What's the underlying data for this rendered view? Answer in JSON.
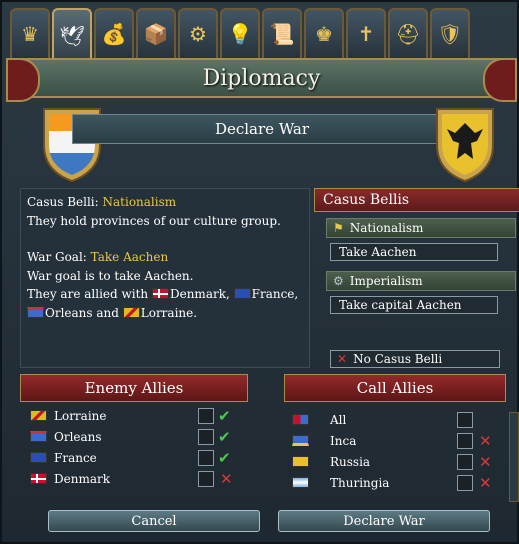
{
  "tabs": [
    {
      "name": "crown-icon",
      "glyph": "♛"
    },
    {
      "name": "dove-icon",
      "glyph": "🕊"
    },
    {
      "name": "money-bag-icon",
      "glyph": "💰"
    },
    {
      "name": "crate-icon",
      "glyph": "📦"
    },
    {
      "name": "gears-icon",
      "glyph": "⚙"
    },
    {
      "name": "lightbulb-icon",
      "glyph": "💡"
    },
    {
      "name": "scroll-icon",
      "glyph": "📜"
    },
    {
      "name": "cap-icon",
      "glyph": "♚"
    },
    {
      "name": "cross-icon",
      "glyph": "✝"
    },
    {
      "name": "helmet-icon",
      "glyph": "⛑"
    },
    {
      "name": "shield-crest-icon",
      "glyph": "🛡"
    }
  ],
  "title": "Diplomacy",
  "subheader": "Declare War",
  "casus_text": {
    "cb_label": "Casus Belli: ",
    "cb_value": "Nationalism",
    "line2": "They hold provinces of our culture group.",
    "wg_label": "War Goal: ",
    "wg_value": "Take Aachen",
    "line4": "War goal is to take Aachen.",
    "allied_prefix": "They are allied with ",
    "ally1": "Denmark,",
    "ally2": "France,",
    "ally3": "Orleans and ",
    "ally4": "Lorraine."
  },
  "casus_bellis": {
    "header": "Casus Bellis",
    "items": [
      {
        "label": "Nationalism",
        "goal": "Take Aachen"
      },
      {
        "label": "Imperialism",
        "goal": "Take capital Aachen"
      }
    ],
    "none_label": "No Casus Belli"
  },
  "enemy_allies": {
    "header": "Enemy Allies",
    "rows": [
      {
        "name": "Lorraine",
        "status": "check"
      },
      {
        "name": "Orleans",
        "status": "check"
      },
      {
        "name": "France",
        "status": "check"
      },
      {
        "name": "Denmark",
        "status": "cross"
      }
    ]
  },
  "call_allies": {
    "header": "Call Allies",
    "rows": [
      {
        "name": "All",
        "status": "none"
      },
      {
        "name": "Inca",
        "status": "cross"
      },
      {
        "name": "Russia",
        "status": "cross"
      },
      {
        "name": "Thuringia",
        "status": "cross"
      }
    ]
  },
  "buttons": {
    "cancel": "Cancel",
    "declare": "Declare War"
  },
  "colors": {
    "accent_gold": "#e8c84a",
    "ribbon_red": "#932a2a",
    "check_green": "#4fc74f",
    "cross_red": "#d23a3a"
  }
}
